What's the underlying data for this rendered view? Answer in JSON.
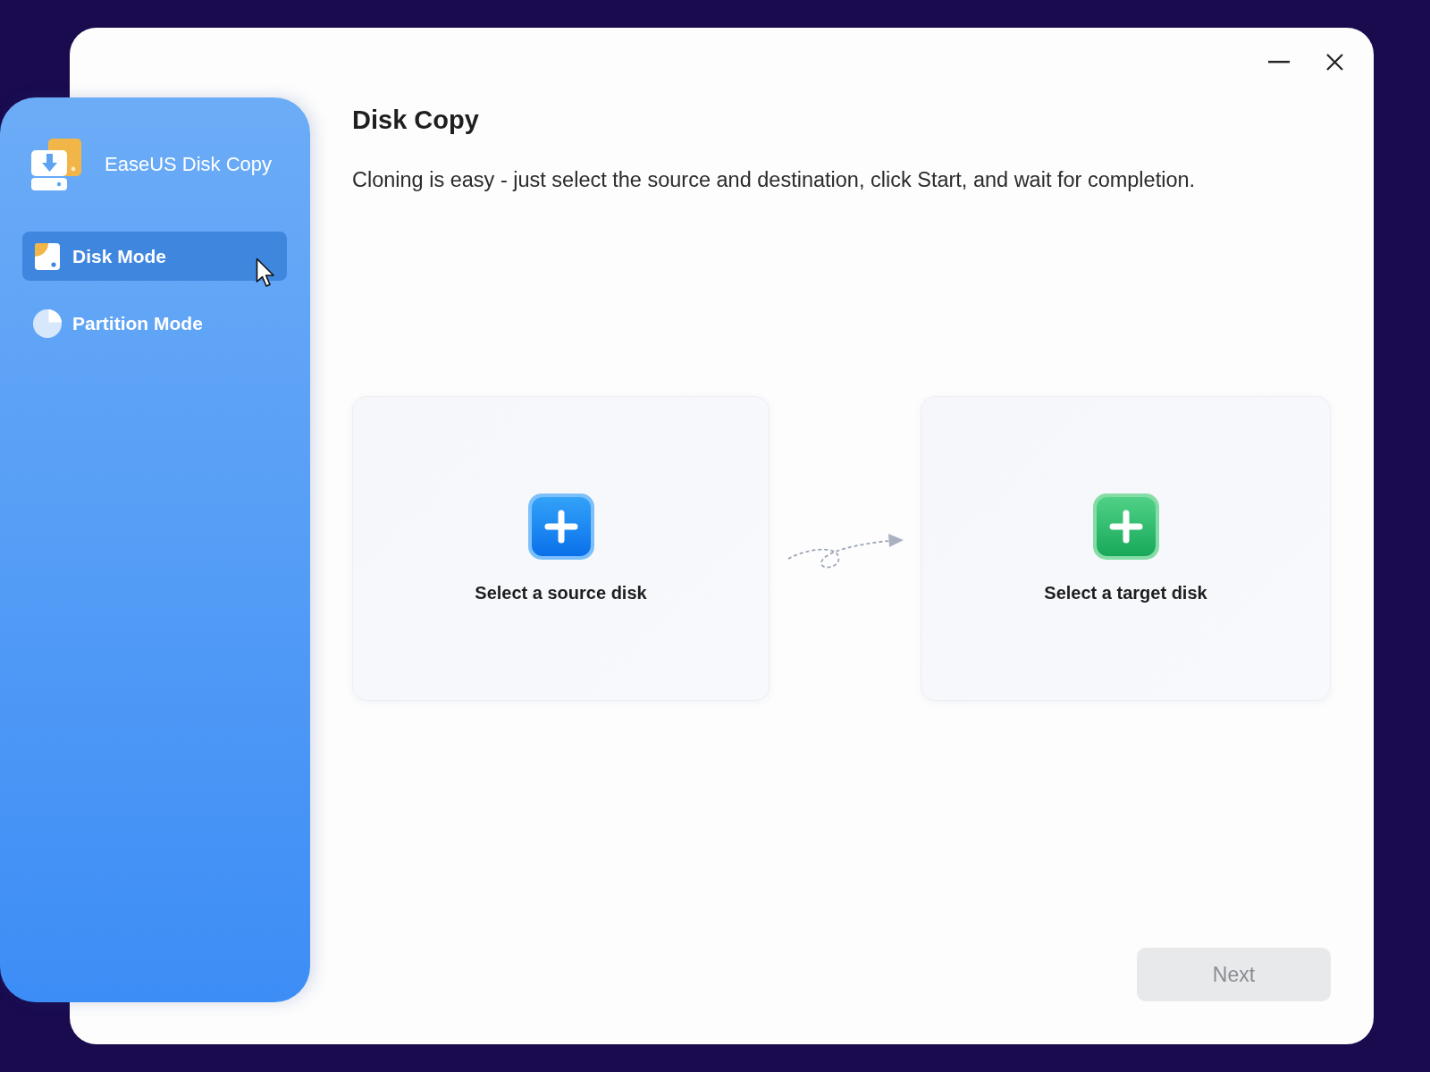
{
  "app": {
    "name": "EaseUS Disk Copy"
  },
  "nav": [
    {
      "label": "Disk Mode",
      "kind": "disk",
      "selected": true
    },
    {
      "label": "Partition Mode",
      "kind": "partition",
      "selected": false
    }
  ],
  "page": {
    "title": "Disk Copy",
    "description": "Cloning is easy - just select the source and destination, click Start, and wait for completion."
  },
  "disk_slots": [
    {
      "label": "Select a source disk",
      "kind": "source"
    },
    {
      "label": "Select a target disk",
      "kind": "target"
    }
  ],
  "next_button": {
    "label": "Next",
    "disabled": true
  }
}
